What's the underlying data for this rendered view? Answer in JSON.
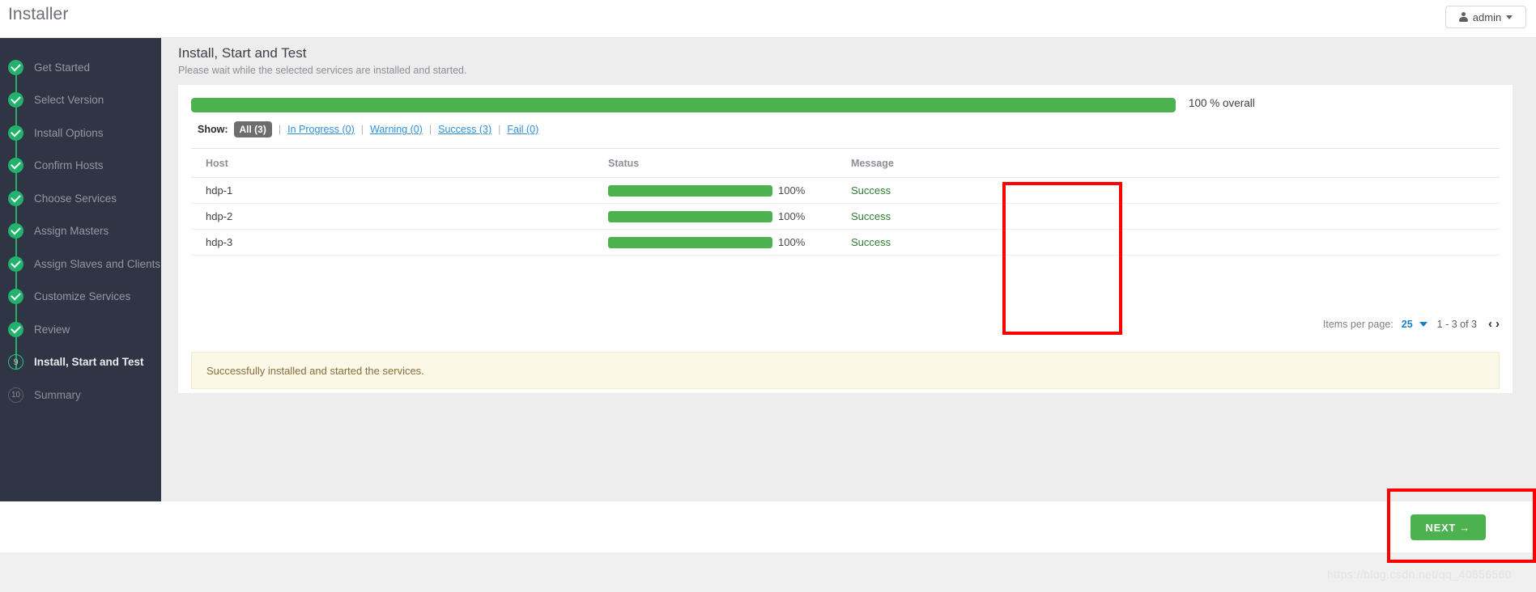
{
  "app": {
    "title": "Installer",
    "user_label": "admin",
    "user_icon": "person-icon",
    "caret_icon": "chevron-down-icon"
  },
  "sidebar": {
    "steps": [
      {
        "label": "Get Started",
        "state": "done",
        "marker": "check"
      },
      {
        "label": "Select Version",
        "state": "done",
        "marker": "check"
      },
      {
        "label": "Install Options",
        "state": "done",
        "marker": "check"
      },
      {
        "label": "Confirm Hosts",
        "state": "done",
        "marker": "check"
      },
      {
        "label": "Choose Services",
        "state": "done",
        "marker": "check"
      },
      {
        "label": "Assign Masters",
        "state": "done",
        "marker": "check"
      },
      {
        "label": "Assign Slaves and Clients",
        "state": "done",
        "marker": "check"
      },
      {
        "label": "Customize Services",
        "state": "done",
        "marker": "check"
      },
      {
        "label": "Review",
        "state": "done",
        "marker": "check"
      },
      {
        "label": "Install, Start and Test",
        "state": "current",
        "marker": "9"
      },
      {
        "label": "Summary",
        "state": "pending",
        "marker": "10"
      }
    ]
  },
  "main": {
    "title": "Install, Start and Test",
    "subtitle": "Please wait while the selected services are installed and started.",
    "overall": {
      "percent": 100,
      "label": "100 % overall"
    },
    "filters": {
      "show_label": "Show:",
      "separator": "|",
      "items": [
        {
          "label": "All (3)",
          "active": true
        },
        {
          "label": "In Progress (0)",
          "active": false
        },
        {
          "label": "Warning (0)",
          "active": false
        },
        {
          "label": "Success (3)",
          "active": false
        },
        {
          "label": "Fail (0)",
          "active": false
        }
      ]
    },
    "table": {
      "columns": [
        "Host",
        "Status",
        "Message"
      ],
      "rows": [
        {
          "host": "hdp-1",
          "percent": 100,
          "percent_label": "100%",
          "message": "Success"
        },
        {
          "host": "hdp-2",
          "percent": 100,
          "percent_label": "100%",
          "message": "Success"
        },
        {
          "host": "hdp-3",
          "percent": 100,
          "percent_label": "100%",
          "message": "Success"
        }
      ]
    },
    "paginator": {
      "items_per_page_label": "Items per page:",
      "items_per_page_value": "25",
      "range_label": "1 - 3 of 3",
      "prev_icon": "‹",
      "next_icon": "›"
    },
    "notice": "Successfully installed and started the services."
  },
  "footer": {
    "next_label": "NEXT →"
  },
  "watermark": "https://blog.csdn.net/qq_40856560",
  "colors": {
    "accent_green": "#4cb14f",
    "step_green": "#23b26d",
    "sidebar_bg": "#2f3545",
    "link_blue": "#2f8fd8",
    "notice_bg": "#fcf8e8",
    "notice_text": "#8a6d3b",
    "annotation_red": "#fe0000",
    "success_text": "#2e7d32"
  }
}
